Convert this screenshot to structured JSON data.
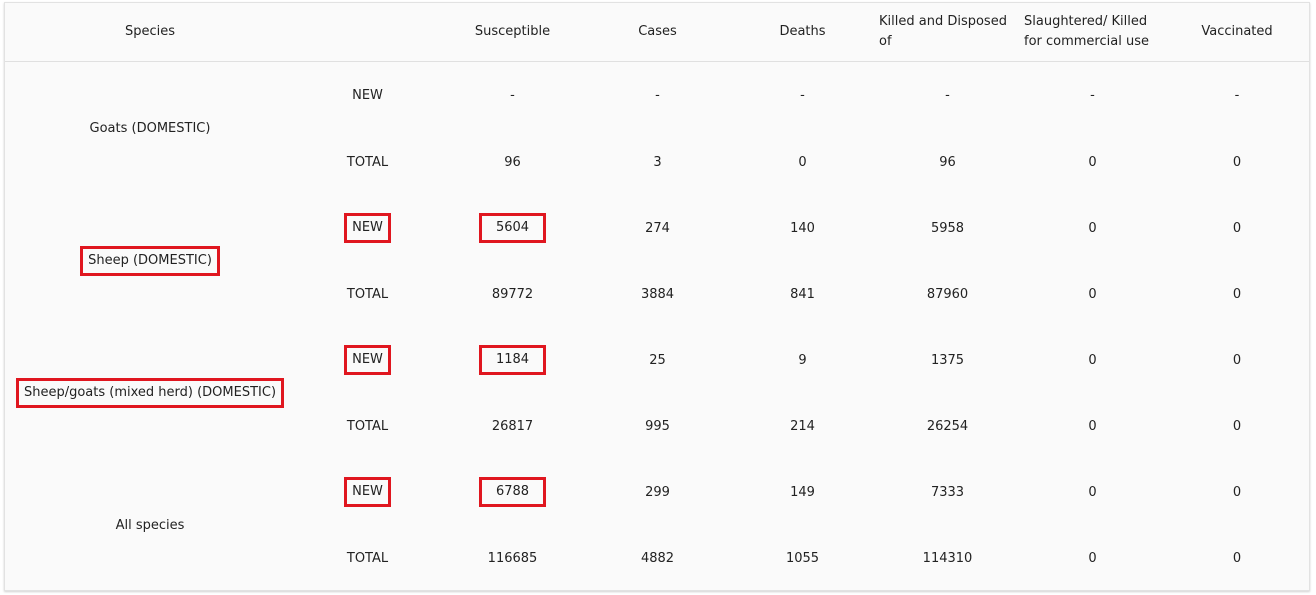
{
  "table": {
    "headers": {
      "species": "Species",
      "type": "",
      "susceptible": "Susceptible",
      "cases": "Cases",
      "deaths": "Deaths",
      "killed_disposed": "Killed and Disposed of",
      "slaughtered": "Slaughtered/ Killed for commercial use",
      "vaccinated": "Vaccinated"
    },
    "groups": [
      {
        "species": "Goats (DOMESTIC)",
        "new": {
          "label": "NEW",
          "susceptible": "-",
          "cases": "-",
          "deaths": "-",
          "killed": "-",
          "slaughtered": "-",
          "vaccinated": "-"
        },
        "total": {
          "label": "TOTAL",
          "susceptible": "96",
          "cases": "3",
          "deaths": "0",
          "killed": "96",
          "slaughtered": "0",
          "vaccinated": "0"
        }
      },
      {
        "species": "Sheep (DOMESTIC)",
        "new": {
          "label": "NEW",
          "susceptible": "5604",
          "cases": "274",
          "deaths": "140",
          "killed": "5958",
          "slaughtered": "0",
          "vaccinated": "0"
        },
        "total": {
          "label": "TOTAL",
          "susceptible": "89772",
          "cases": "3884",
          "deaths": "841",
          "killed": "87960",
          "slaughtered": "0",
          "vaccinated": "0"
        }
      },
      {
        "species": "Sheep/goats (mixed herd) (DOMESTIC)",
        "new": {
          "label": "NEW",
          "susceptible": "1184",
          "cases": "25",
          "deaths": "9",
          "killed": "1375",
          "slaughtered": "0",
          "vaccinated": "0"
        },
        "total": {
          "label": "TOTAL",
          "susceptible": "26817",
          "cases": "995",
          "deaths": "214",
          "killed": "26254",
          "slaughtered": "0",
          "vaccinated": "0"
        }
      },
      {
        "species": "All species",
        "new": {
          "label": "NEW",
          "susceptible": "6788",
          "cases": "299",
          "deaths": "149",
          "killed": "7333",
          "slaughtered": "0",
          "vaccinated": "0"
        },
        "total": {
          "label": "TOTAL",
          "susceptible": "116685",
          "cases": "4882",
          "deaths": "1055",
          "killed": "114310",
          "slaughtered": "0",
          "vaccinated": "0"
        }
      }
    ]
  },
  "highlight_color": "#e0161f"
}
